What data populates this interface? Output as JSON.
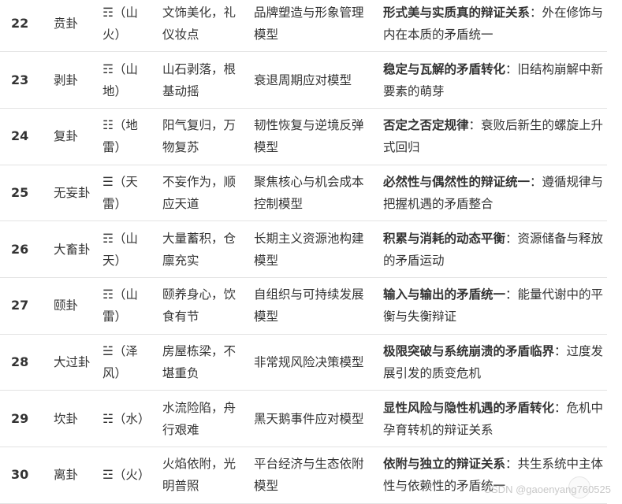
{
  "rows": [
    {
      "num": "22",
      "name": "贲卦",
      "symbol": "☶",
      "trigram": "（山火）",
      "image": "文饰美化，礼仪妆点",
      "model": "品牌塑造与形象管理模型",
      "keyword": "形式美与实质真的辩证关系",
      "desc": "：外在修饰与内在本质的矛盾统一"
    },
    {
      "num": "23",
      "name": "剥卦",
      "symbol": "☶",
      "trigram": "（山地）",
      "image": "山石剥落，根基动摇",
      "model": "衰退周期应对模型",
      "keyword": "稳定与瓦解的矛盾转化",
      "desc": "：旧结构崩解中新要素的萌芽"
    },
    {
      "num": "24",
      "name": "复卦",
      "symbol": "☷",
      "trigram": "（地雷）",
      "image": "阳气复归，万物复苏",
      "model": "韧性恢复与逆境反弹模型",
      "keyword": "否定之否定规律",
      "desc": "：衰败后新生的螺旋上升式回归"
    },
    {
      "num": "25",
      "name": "无妄卦",
      "symbol": "☰",
      "trigram": "（天雷）",
      "image": "不妄作为，顺应天道",
      "model": "聚焦核心与机会成本控制模型",
      "keyword": "必然性与偶然性的辩证统一",
      "desc": "：遵循规律与把握机遇的矛盾整合"
    },
    {
      "num": "26",
      "name": "大畜卦",
      "symbol": "☶",
      "trigram": "（山天）",
      "image": "大量蓄积，仓廪充实",
      "model": "长期主义资源池构建模型",
      "keyword": "积累与消耗的动态平衡",
      "desc": "：资源储备与释放的矛盾运动"
    },
    {
      "num": "27",
      "name": "颐卦",
      "symbol": "☶",
      "trigram": "（山雷）",
      "image": "颐养身心，饮食有节",
      "model": "自组织与可持续发展模型",
      "keyword": "输入与输出的矛盾统一",
      "desc": "：能量代谢中的平衡与失衡辩证"
    },
    {
      "num": "28",
      "name": "大过卦",
      "symbol": "☱",
      "trigram": "（泽风）",
      "image": "房屋栋梁，不堪重负",
      "model": "非常规风险决策模型",
      "keyword": "极限突破与系统崩溃的矛盾临界",
      "desc": "：过度发展引发的质变危机"
    },
    {
      "num": "29",
      "name": "坎卦",
      "symbol": "☵",
      "trigram": "（水）",
      "image": "水流险陷，舟行艰难",
      "model": "黑天鹅事件应对模型",
      "keyword": "显性风险与隐性机遇的矛盾转化",
      "desc": "：危机中孕育转机的辩证关系"
    },
    {
      "num": "30",
      "name": "离卦",
      "symbol": "☲",
      "trigram": "（火）",
      "image": "火焰依附，光明普照",
      "model": "平台经济与生态依附模型",
      "keyword": "依附与独立的辩证关系",
      "desc": "：共生系统中主体性与依赖性的矛盾统一"
    }
  ],
  "watermark": "CSDN @gaoenyang760525",
  "icons": {
    "watermark": "paw-logo-icon"
  }
}
